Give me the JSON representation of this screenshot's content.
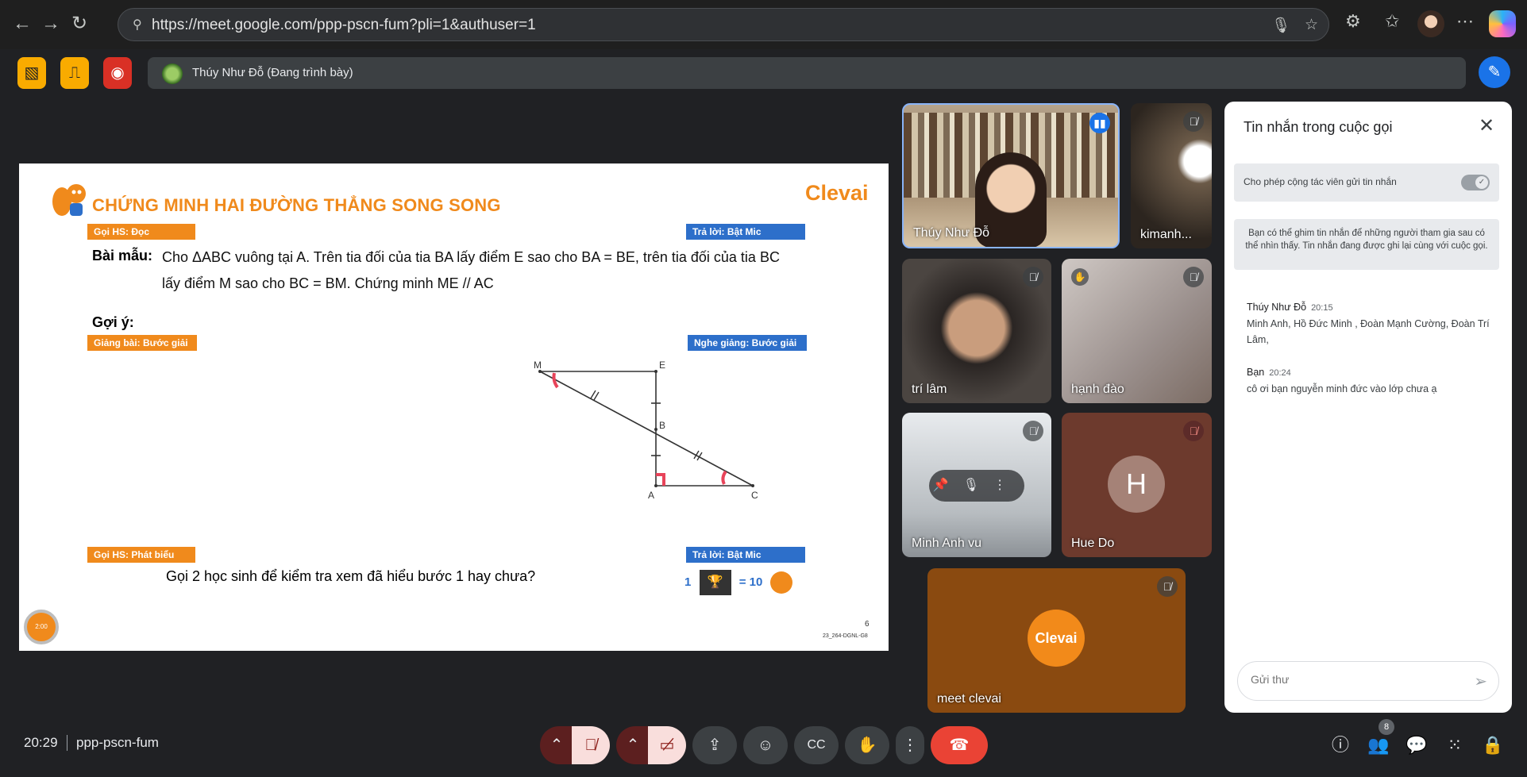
{
  "browser": {
    "url": "https://meet.google.com/ppp-pscn-fum?pli=1&authuser=1"
  },
  "meet": {
    "presenter_label": "Thúy Như Đỗ (Đang trình bày)",
    "slide": {
      "brand": "Clevai",
      "title": "CHỨNG MINH HAI ĐƯỜNG THẲNG SONG SONG",
      "tag_read": "Gọi HS: Đọc",
      "tag_answer_1": "Trả lời: Bật Mic",
      "sample_label": "Bài mẫu:",
      "sample_line1": "Cho ΔABC vuông tại A. Trên tia đối của tia BA lấy điểm E sao cho BA = BE, trên tia đối của tia BC",
      "sample_line2": "lấy điểm M sao cho BC = BM. Chứng minh ME // AC",
      "hint_label": "Gợi ý:",
      "tag_teach": "Giảng bài: Bước giải",
      "tag_listen": "Nghe giảng: Bước giải",
      "point_M": "M",
      "point_E": "E",
      "point_B": "B",
      "point_A": "A",
      "point_C": "C",
      "tag_speak": "Gọi HS: Phát biểu",
      "tag_answer_2": "Trả lời: Bật Mic",
      "question": "Gọi 2 học sinh để kiểm tra xem đã hiểu bước 1 hay chưa?",
      "reward_count": "1",
      "reward_eq": "= 10",
      "page_number": "6",
      "slide_code": "23_264-DGNL-G8",
      "timer": "2:00"
    },
    "participants": [
      {
        "name": "Thúy Như Đỗ"
      },
      {
        "name": "kimanh..."
      },
      {
        "name": "trí lâm"
      },
      {
        "name": "hạnh đào"
      },
      {
        "name": "Minh Anh vu"
      },
      {
        "name": "Hue Do",
        "initial": "H"
      },
      {
        "name": "meet clevai",
        "logo": "Clevai"
      }
    ],
    "chat": {
      "title": "Tin nhắn trong cuộc gọi",
      "toggle_label": "Cho phép cộng tác viên gửi tin nhắn",
      "info": "Bạn có thể ghim tin nhắn để những người tham gia sau có thể nhìn thấy. Tin nhắn đang được ghi lại cùng với cuộc gọi.",
      "messages": [
        {
          "sender": "Thúy Như Đỗ",
          "time": "20:15",
          "text": "Minh Anh, Hồ Đức Minh , Đoàn Mạnh Cường, Đoàn Trí Lâm,"
        },
        {
          "sender": "Bạn",
          "time": "20:24",
          "text": "cô ơi bạn nguyễn minh đức vào lớp chưa ạ"
        }
      ],
      "input_placeholder": "Gửi thư"
    },
    "bottom": {
      "time": "20:29",
      "meeting_code": "ppp-pscn-fum",
      "people_count": "8"
    }
  }
}
